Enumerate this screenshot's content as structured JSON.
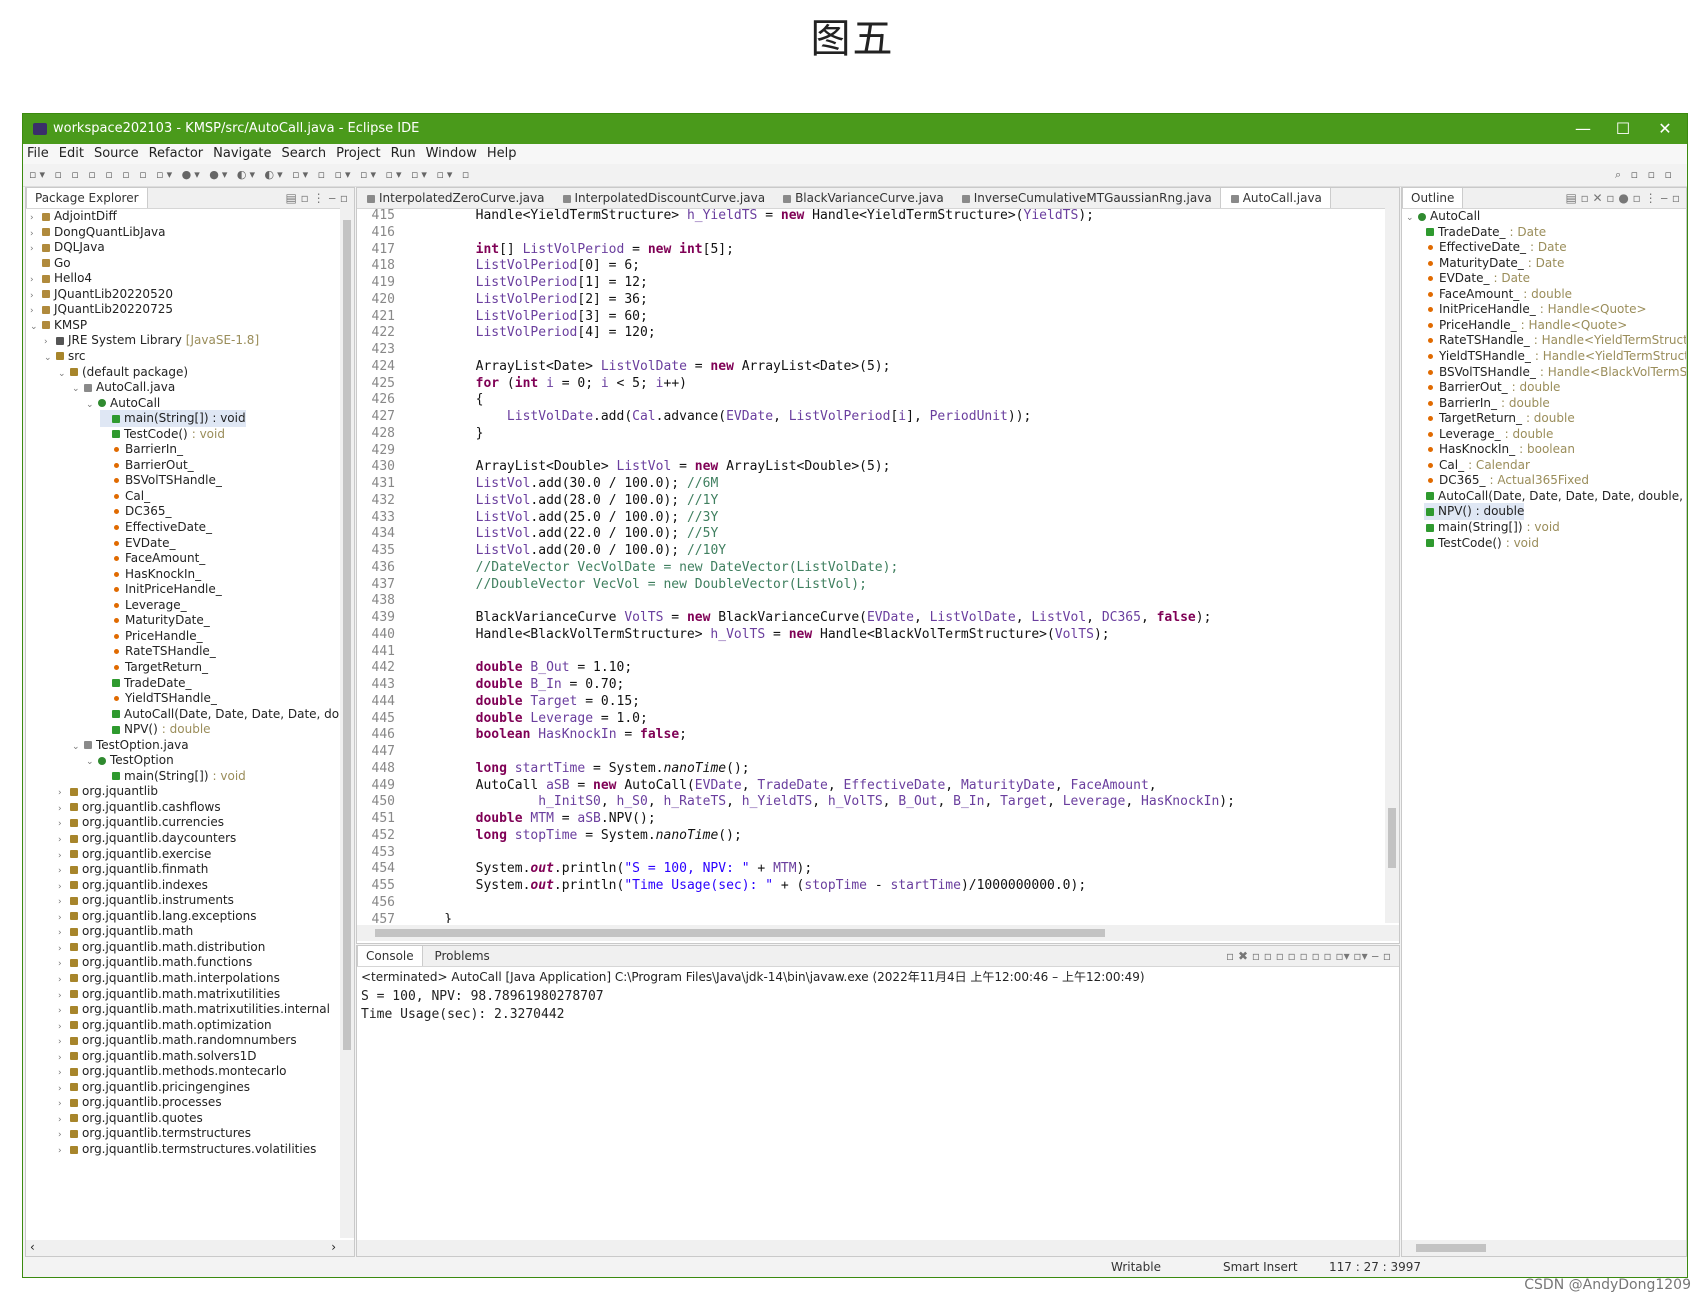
{
  "caption": "图五",
  "window": {
    "title": "workspace202103 - KMSP/src/AutoCall.java - Eclipse IDE",
    "controls": [
      "—",
      "☐",
      "✕"
    ]
  },
  "menu": [
    "File",
    "Edit",
    "Source",
    "Refactor",
    "Navigate",
    "Search",
    "Project",
    "Run",
    "Window",
    "Help"
  ],
  "package_explorer": {
    "title": "Package Explorer",
    "items": [
      {
        "text": "AdjointDiff",
        "level": 0,
        "icon": "proj",
        "arrow": "›"
      },
      {
        "text": "DongQuantLibJava",
        "level": 0,
        "icon": "proj",
        "arrow": "›"
      },
      {
        "text": "DQLJava",
        "level": 0,
        "icon": "proj",
        "arrow": "›"
      },
      {
        "text": "Go",
        "level": 0,
        "icon": "proj",
        "arrow": ""
      },
      {
        "text": "Hello4",
        "level": 0,
        "icon": "proj",
        "arrow": "›"
      },
      {
        "text": "JQuantLib20220520",
        "level": 0,
        "icon": "proj",
        "arrow": "›"
      },
      {
        "text": "JQuantLib20220725",
        "level": 0,
        "icon": "proj",
        "arrow": "›"
      },
      {
        "text": "KMSP",
        "level": 0,
        "icon": "proj",
        "arrow": "⌄"
      },
      {
        "text": "JRE System Library",
        "suffix": "[JavaSE-1.8]",
        "level": 1,
        "icon": "lib",
        "arrow": "›"
      },
      {
        "text": "src",
        "level": 1,
        "icon": "pkg",
        "arrow": "⌄"
      },
      {
        "text": "(default package)",
        "level": 2,
        "icon": "pkg",
        "arrow": "⌄"
      },
      {
        "text": "AutoCall.java",
        "level": 3,
        "icon": "file",
        "arrow": "⌄"
      },
      {
        "text": "AutoCall",
        "level": 4,
        "icon": "class",
        "arrow": "⌄"
      },
      {
        "text": "main(String[]) : void",
        "level": 5,
        "icon": "meth",
        "arrow": "",
        "selected": true
      },
      {
        "text": "TestCode()",
        "suffix": ": void",
        "level": 5,
        "icon": "meth",
        "arrow": ""
      },
      {
        "text": "BarrierIn_",
        "level": 5,
        "icon": "field",
        "arrow": ""
      },
      {
        "text": "BarrierOut_",
        "level": 5,
        "icon": "field",
        "arrow": ""
      },
      {
        "text": "BSVolTSHandle_",
        "level": 5,
        "icon": "field",
        "arrow": ""
      },
      {
        "text": "Cal_",
        "level": 5,
        "icon": "field",
        "arrow": ""
      },
      {
        "text": "DC365_",
        "level": 5,
        "icon": "field",
        "arrow": ""
      },
      {
        "text": "EffectiveDate_",
        "level": 5,
        "icon": "field",
        "arrow": ""
      },
      {
        "text": "EVDate_",
        "level": 5,
        "icon": "field",
        "arrow": ""
      },
      {
        "text": "FaceAmount_",
        "level": 5,
        "icon": "field",
        "arrow": ""
      },
      {
        "text": "HasKnockIn_",
        "level": 5,
        "icon": "field",
        "arrow": ""
      },
      {
        "text": "InitPriceHandle_",
        "level": 5,
        "icon": "field",
        "arrow": ""
      },
      {
        "text": "Leverage_",
        "level": 5,
        "icon": "field",
        "arrow": ""
      },
      {
        "text": "MaturityDate_",
        "level": 5,
        "icon": "field",
        "arrow": ""
      },
      {
        "text": "PriceHandle_",
        "level": 5,
        "icon": "field",
        "arrow": ""
      },
      {
        "text": "RateTSHandle_",
        "level": 5,
        "icon": "field",
        "arrow": ""
      },
      {
        "text": "TargetReturn_",
        "level": 5,
        "icon": "field",
        "arrow": ""
      },
      {
        "text": "TradeDate_",
        "level": 5,
        "icon": "meth",
        "arrow": ""
      },
      {
        "text": "YieldTSHandle_",
        "level": 5,
        "icon": "field",
        "arrow": ""
      },
      {
        "text": "AutoCall(Date, Date, Date, Date, doub",
        "level": 5,
        "icon": "meth",
        "arrow": ""
      },
      {
        "text": "NPV()",
        "suffix": ": double",
        "level": 5,
        "icon": "meth",
        "arrow": ""
      },
      {
        "text": "TestOption.java",
        "level": 3,
        "icon": "file",
        "arrow": "⌄"
      },
      {
        "text": "TestOption",
        "level": 4,
        "icon": "class",
        "arrow": "⌄"
      },
      {
        "text": "main(String[])",
        "suffix": ": void",
        "level": 5,
        "icon": "meth",
        "arrow": ""
      },
      {
        "text": "org.jquantlib",
        "level": 2,
        "icon": "pkg",
        "arrow": "›"
      },
      {
        "text": "org.jquantlib.cashflows",
        "level": 2,
        "icon": "pkg",
        "arrow": "›"
      },
      {
        "text": "org.jquantlib.currencies",
        "level": 2,
        "icon": "pkg",
        "arrow": "›"
      },
      {
        "text": "org.jquantlib.daycounters",
        "level": 2,
        "icon": "pkg",
        "arrow": "›"
      },
      {
        "text": "org.jquantlib.exercise",
        "level": 2,
        "icon": "pkg",
        "arrow": "›"
      },
      {
        "text": "org.jquantlib.finmath",
        "level": 2,
        "icon": "pkg",
        "arrow": "›"
      },
      {
        "text": "org.jquantlib.indexes",
        "level": 2,
        "icon": "pkg",
        "arrow": "›"
      },
      {
        "text": "org.jquantlib.instruments",
        "level": 2,
        "icon": "pkg",
        "arrow": "›"
      },
      {
        "text": "org.jquantlib.lang.exceptions",
        "level": 2,
        "icon": "pkg",
        "arrow": "›"
      },
      {
        "text": "org.jquantlib.math",
        "level": 2,
        "icon": "pkg",
        "arrow": "›"
      },
      {
        "text": "org.jquantlib.math.distribution",
        "level": 2,
        "icon": "pkg",
        "arrow": "›"
      },
      {
        "text": "org.jquantlib.math.functions",
        "level": 2,
        "icon": "pkg",
        "arrow": "›"
      },
      {
        "text": "org.jquantlib.math.interpolations",
        "level": 2,
        "icon": "pkg",
        "arrow": "›"
      },
      {
        "text": "org.jquantlib.math.matrixutilities",
        "level": 2,
        "icon": "pkg",
        "arrow": "›"
      },
      {
        "text": "org.jquantlib.math.matrixutilities.internal",
        "level": 2,
        "icon": "pkg",
        "arrow": "›"
      },
      {
        "text": "org.jquantlib.math.optimization",
        "level": 2,
        "icon": "pkg",
        "arrow": "›"
      },
      {
        "text": "org.jquantlib.math.randomnumbers",
        "level": 2,
        "icon": "pkg",
        "arrow": "›"
      },
      {
        "text": "org.jquantlib.math.solvers1D",
        "level": 2,
        "icon": "pkg",
        "arrow": "›"
      },
      {
        "text": "org.jquantlib.methods.montecarlo",
        "level": 2,
        "icon": "pkg",
        "arrow": "›"
      },
      {
        "text": "org.jquantlib.pricingengines",
        "level": 2,
        "icon": "pkg",
        "arrow": "›"
      },
      {
        "text": "org.jquantlib.processes",
        "level": 2,
        "icon": "pkg",
        "arrow": "›"
      },
      {
        "text": "org.jquantlib.quotes",
        "level": 2,
        "icon": "pkg",
        "arrow": "›"
      },
      {
        "text": "org.jquantlib.termstructures",
        "level": 2,
        "icon": "pkg",
        "arrow": "›"
      },
      {
        "text": "org.jquantlib.termstructures.volatilities",
        "level": 2,
        "icon": "pkg",
        "arrow": "›"
      }
    ]
  },
  "editor": {
    "tabs": [
      {
        "label": "InterpolatedZeroCurve.java",
        "active": false
      },
      {
        "label": "InterpolatedDiscountCurve.java",
        "active": false
      },
      {
        "label": "BlackVarianceCurve.java",
        "active": false
      },
      {
        "label": "InverseCumulativeMTGaussianRng.java",
        "active": false
      },
      {
        "label": "AutoCall.java",
        "active": true
      }
    ],
    "lines": [
      {
        "n": "415",
        "c": "        Handle<YieldTermStructure> h_YieldTS = new Handle<YieldTermStructure>(YieldTS);"
      },
      {
        "n": "416",
        "c": ""
      },
      {
        "n": "417",
        "c": "        int[] ListVolPeriod = new int[5];"
      },
      {
        "n": "418",
        "c": "        ListVolPeriod[0] = 6;"
      },
      {
        "n": "419",
        "c": "        ListVolPeriod[1] = 12;"
      },
      {
        "n": "420",
        "c": "        ListVolPeriod[2] = 36;"
      },
      {
        "n": "421",
        "c": "        ListVolPeriod[3] = 60;"
      },
      {
        "n": "422",
        "c": "        ListVolPeriod[4] = 120;"
      },
      {
        "n": "423",
        "c": ""
      },
      {
        "n": "424",
        "c": "        ArrayList<Date> ListVolDate = new ArrayList<Date>(5);"
      },
      {
        "n": "425",
        "c": "        for (int i = 0; i < 5; i++)"
      },
      {
        "n": "426",
        "c": "        {"
      },
      {
        "n": "427",
        "c": "            ListVolDate.add(Cal.advance(EVDate, ListVolPeriod[i], PeriodUnit));"
      },
      {
        "n": "428",
        "c": "        }"
      },
      {
        "n": "429",
        "c": ""
      },
      {
        "n": "430",
        "c": "        ArrayList<Double> ListVol = new ArrayList<Double>(5);"
      },
      {
        "n": "431",
        "c": "        ListVol.add(30.0 / 100.0); //6M"
      },
      {
        "n": "432",
        "c": "        ListVol.add(28.0 / 100.0); //1Y"
      },
      {
        "n": "433",
        "c": "        ListVol.add(25.0 / 100.0); //3Y"
      },
      {
        "n": "434",
        "c": "        ListVol.add(22.0 / 100.0); //5Y"
      },
      {
        "n": "435",
        "c": "        ListVol.add(20.0 / 100.0); //10Y"
      },
      {
        "n": "436",
        "c": "        //DateVector VecVolDate = new DateVector(ListVolDate);"
      },
      {
        "n": "437",
        "c": "        //DoubleVector VecVol = new DoubleVector(ListVol);"
      },
      {
        "n": "438",
        "c": ""
      },
      {
        "n": "439",
        "c": "        BlackVarianceCurve VolTS = new BlackVarianceCurve(EVDate, ListVolDate, ListVol, DC365, false);"
      },
      {
        "n": "440",
        "c": "        Handle<BlackVolTermStructure> h_VolTS = new Handle<BlackVolTermStructure>(VolTS);"
      },
      {
        "n": "441",
        "c": ""
      },
      {
        "n": "442",
        "c": "        double B_Out = 1.10;"
      },
      {
        "n": "443",
        "c": "        double B_In = 0.70;"
      },
      {
        "n": "444",
        "c": "        double Target = 0.15;"
      },
      {
        "n": "445",
        "c": "        double Leverage = 1.0;"
      },
      {
        "n": "446",
        "c": "        boolean HasKnockIn = false;"
      },
      {
        "n": "447",
        "c": ""
      },
      {
        "n": "448",
        "c": "        long startTime = System.nanoTime();"
      },
      {
        "n": "449",
        "c": "        AutoCall aSB = new AutoCall(EVDate, TradeDate, EffectiveDate, MaturityDate, FaceAmount,"
      },
      {
        "n": "450",
        "c": "                h_InitS0, h_S0, h_RateTS, h_YieldTS, h_VolTS, B_Out, B_In, Target, Leverage, HasKnockIn);"
      },
      {
        "n": "451",
        "c": "        double MTM = aSB.NPV();"
      },
      {
        "n": "452",
        "c": "        long stopTime = System.nanoTime();"
      },
      {
        "n": "453",
        "c": ""
      },
      {
        "n": "454",
        "c": "        System.out.println(\"S = 100, NPV: \" + MTM);"
      },
      {
        "n": "455",
        "c": "        System.out.println(\"Time Usage(sec): \" + (stopTime - startTime)/1000000000.0);"
      },
      {
        "n": "456",
        "c": ""
      },
      {
        "n": "457",
        "c": "    }"
      },
      {
        "n": "458",
        "c": ""
      }
    ]
  },
  "console": {
    "tabs": [
      "Console",
      "Problems"
    ],
    "header": "<terminated> AutoCall [Java Application] C:\\Program Files\\Java\\jdk-14\\bin\\javaw.exe  (2022年11月4日 上午12:00:46 – 上午12:00:49)",
    "output": [
      "S = 100, NPV: 98.78961980278707",
      "Time Usage(sec): 2.3270442"
    ]
  },
  "outline": {
    "title": "Outline",
    "items": [
      {
        "name": "AutoCall",
        "type": "",
        "level": 0,
        "icon": "class"
      },
      {
        "name": "TradeDate_",
        "type": ": Date",
        "level": 1,
        "icon": "meth"
      },
      {
        "name": "EffectiveDate_",
        "type": ": Date",
        "level": 1,
        "icon": "field"
      },
      {
        "name": "MaturityDate_",
        "type": ": Date",
        "level": 1,
        "icon": "field"
      },
      {
        "name": "EVDate_",
        "type": ": Date",
        "level": 1,
        "icon": "field"
      },
      {
        "name": "FaceAmount_",
        "type": ": double",
        "level": 1,
        "icon": "field"
      },
      {
        "name": "InitPriceHandle_",
        "type": ": Handle<Quote>",
        "level": 1,
        "icon": "field"
      },
      {
        "name": "PriceHandle_",
        "type": ": Handle<Quote>",
        "level": 1,
        "icon": "field"
      },
      {
        "name": "RateTSHandle_",
        "type": ": Handle<YieldTermStructure>",
        "level": 1,
        "icon": "field"
      },
      {
        "name": "YieldTSHandle_",
        "type": ": Handle<YieldTermStructure>",
        "level": 1,
        "icon": "field"
      },
      {
        "name": "BSVolTSHandle_",
        "type": ": Handle<BlackVolTermStruct",
        "level": 1,
        "icon": "field"
      },
      {
        "name": "BarrierOut_",
        "type": ": double",
        "level": 1,
        "icon": "field"
      },
      {
        "name": "BarrierIn_",
        "type": ": double",
        "level": 1,
        "icon": "field"
      },
      {
        "name": "TargetReturn_",
        "type": ": double",
        "level": 1,
        "icon": "field"
      },
      {
        "name": "Leverage_",
        "type": ": double",
        "level": 1,
        "icon": "field"
      },
      {
        "name": "HasKnockIn_",
        "type": ": boolean",
        "level": 1,
        "icon": "field"
      },
      {
        "name": "Cal_",
        "type": ": Calendar",
        "level": 1,
        "icon": "field"
      },
      {
        "name": "DC365_",
        "type": ": Actual365Fixed",
        "level": 1,
        "icon": "field"
      },
      {
        "name": "AutoCall(Date, Date, Date, Date, double, Handl",
        "type": "",
        "level": 1,
        "icon": "meth"
      },
      {
        "name": "NPV() : double",
        "type": "",
        "level": 1,
        "icon": "meth",
        "selected": true
      },
      {
        "name": "main(String[])",
        "type": ": void",
        "level": 1,
        "icon": "meth"
      },
      {
        "name": "TestCode()",
        "type": ": void",
        "level": 1,
        "icon": "meth"
      }
    ]
  },
  "status": {
    "writable": "Writable",
    "insert": "Smart Insert",
    "position": "117 : 27 : 3997"
  },
  "watermark": "CSDN @AndyDong1209"
}
